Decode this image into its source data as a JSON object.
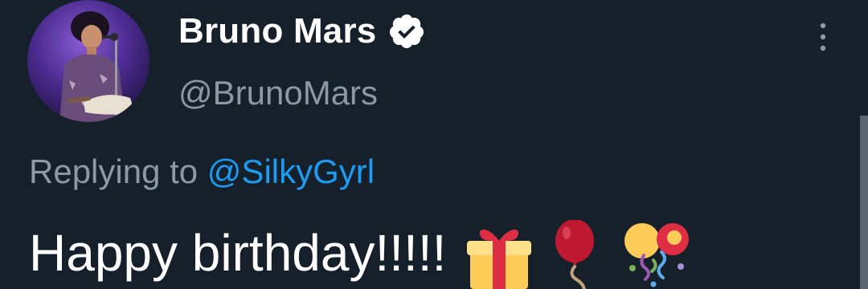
{
  "tweet": {
    "author": {
      "display_name": "Bruno Mars",
      "handle": "@BrunoMars",
      "verified": true,
      "avatar": "avatar-photo"
    },
    "more_icon": "more-options-icon",
    "reply": {
      "prefix": "Replying to",
      "mention": "@SilkyGyrl"
    },
    "text": "Happy birthday!!!!!",
    "emojis": [
      "gift-emoji",
      "balloon-emoji",
      "party-popper-emoji"
    ]
  },
  "colors": {
    "background": "#15202b",
    "primary_text": "#ffffff",
    "secondary_text": "#8b98a5",
    "link": "#1d9bf0"
  }
}
